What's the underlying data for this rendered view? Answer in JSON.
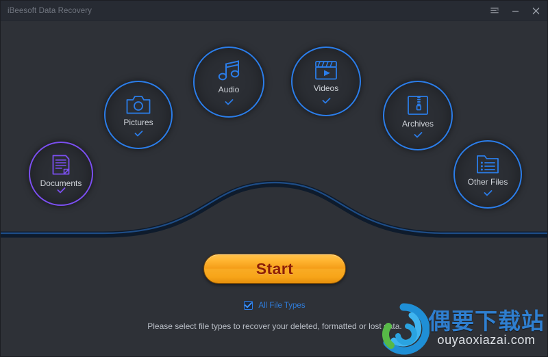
{
  "window": {
    "title": "iBeesoft Data Recovery",
    "controls": [
      {
        "name": "menu",
        "icon": "list-menu-icon",
        "label": "Menu"
      },
      {
        "name": "minimize",
        "icon": "minimize-icon",
        "label": "Minimize"
      },
      {
        "name": "close",
        "icon": "close-icon",
        "label": "Close"
      }
    ]
  },
  "colors": {
    "background": "#2e3137",
    "titlebar": "#272b33",
    "accent_blue": "#2b7de9",
    "accent_purple": "#7b4ff0",
    "start_orange": "#f7a519",
    "start_text": "#8d1f06",
    "wave": "#1b3f6e"
  },
  "categories": [
    {
      "id": "documents",
      "label": "Documents",
      "icon": "document-icon",
      "color": "#7b4ff0",
      "selected": true,
      "check": "checkmark-icon"
    },
    {
      "id": "pictures",
      "label": "Pictures",
      "icon": "camera-icon",
      "color": "#2b7de9",
      "selected": true,
      "check": "checkmark-icon"
    },
    {
      "id": "audio",
      "label": "Audio",
      "icon": "music-note-icon",
      "color": "#2b7de9",
      "selected": true,
      "check": "checkmark-icon"
    },
    {
      "id": "videos",
      "label": "Videos",
      "icon": "clapperboard-icon",
      "color": "#2b7de9",
      "selected": true,
      "check": "checkmark-icon"
    },
    {
      "id": "archives",
      "label": "Archives",
      "icon": "zip-archive-icon",
      "color": "#2b7de9",
      "selected": true,
      "check": "checkmark-icon"
    },
    {
      "id": "other",
      "label": "Other Files",
      "icon": "folder-list-icon",
      "color": "#2b7de9",
      "selected": true,
      "check": "checkmark-icon"
    }
  ],
  "start_button": {
    "label": "Start"
  },
  "all_file_types": {
    "label": "All File Types",
    "checked": true
  },
  "hint": {
    "text": "Please select file types to recover your deleted, formatted or lost data."
  },
  "watermark": {
    "cn": "偶要下载站",
    "en": "ouyaoxiazai.com",
    "logo": "swirl-logo-icon"
  }
}
